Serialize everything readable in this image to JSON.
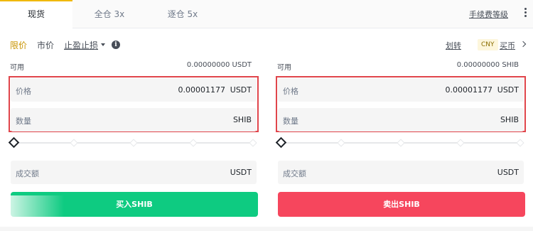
{
  "tabs": {
    "spot": "现货",
    "cross": "全仓 3x",
    "isolated": "逐仓 5x",
    "fee_level": "手续费等级"
  },
  "order_types": {
    "limit": "限价",
    "market": "市价",
    "stop_limit": "止盈止损"
  },
  "right_links": {
    "transfer": "划转",
    "currency_badge": "CNY",
    "buy_coin": "买币"
  },
  "buy_panel": {
    "available_label": "可用",
    "available_value": "0.00000000 USDT",
    "price_label": "价格",
    "price_value": "0.00001177",
    "price_unit": "USDT",
    "quantity_label": "数量",
    "quantity_unit": "SHIB",
    "total_label": "成交额",
    "total_unit": "USDT",
    "slider_percent": 0,
    "action_label": "买入SHIB",
    "action_color": "#0ecb81"
  },
  "sell_panel": {
    "available_label": "可用",
    "available_value": "0.00000000 SHIB",
    "price_label": "价格",
    "price_value": "0.00001177",
    "price_unit": "USDT",
    "quantity_label": "数量",
    "quantity_unit": "SHIB",
    "total_label": "成交额",
    "total_unit": "USDT",
    "slider_percent": 0,
    "action_label": "卖出SHIB",
    "action_color": "#f6465d"
  },
  "colors": {
    "accent": "#f0b90b",
    "highlight_border": "#e0454b"
  },
  "icons": [
    "info-icon",
    "more-vertical-icon",
    "chevron-right-icon",
    "caret-down-icon",
    "slider-handle-icon"
  ]
}
